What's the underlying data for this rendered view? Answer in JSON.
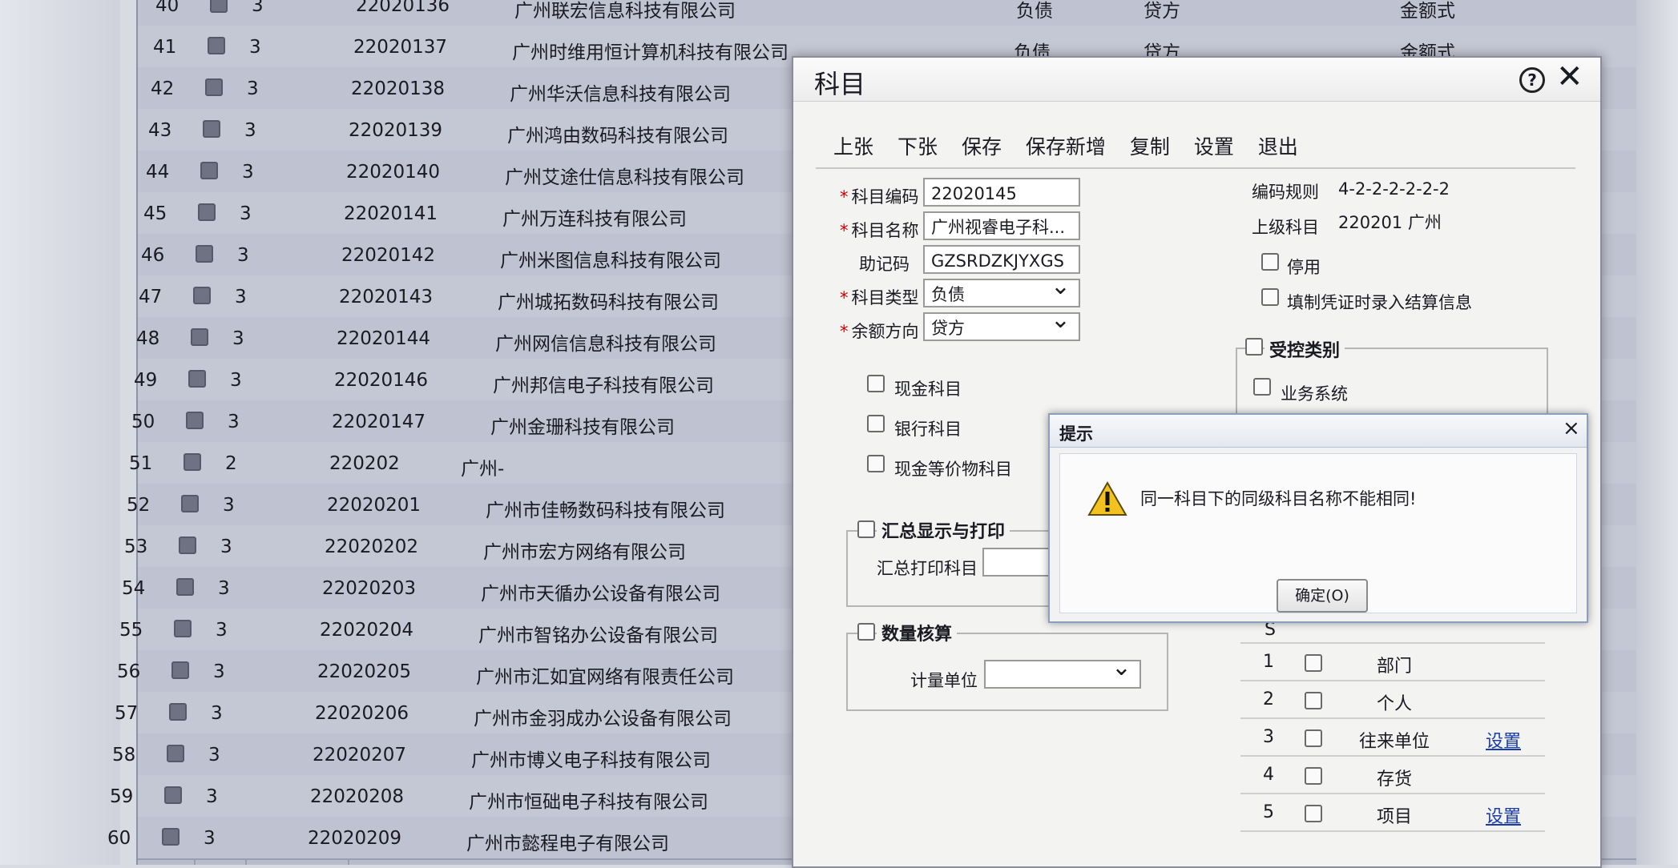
{
  "rows": [
    {
      "num": "40",
      "level": "3",
      "code": "22020136",
      "name": "广州联宏信息科技有限公司",
      "type": "负债",
      "dir": "贷方",
      "fmt": "金额式"
    },
    {
      "num": "41",
      "level": "3",
      "code": "22020137",
      "name": "广州时维用恒计算机科技有限公司",
      "type": "负债",
      "dir": "贷方",
      "fmt": "金额式"
    },
    {
      "num": "42",
      "level": "3",
      "code": "22020138",
      "name": "广州华沃信息科技有限公司",
      "type": "",
      "dir": "",
      "fmt": ""
    },
    {
      "num": "43",
      "level": "3",
      "code": "22020139",
      "name": "广州鸿由数码科技有限公司",
      "type": "",
      "dir": "",
      "fmt": ""
    },
    {
      "num": "44",
      "level": "3",
      "code": "22020140",
      "name": "广州艾途仕信息科技有限公司",
      "type": "",
      "dir": "",
      "fmt": ""
    },
    {
      "num": "45",
      "level": "3",
      "code": "22020141",
      "name": "广州万连科技有限公司",
      "type": "",
      "dir": "",
      "fmt": ""
    },
    {
      "num": "46",
      "level": "3",
      "code": "22020142",
      "name": "广州米图信息科技有限公司",
      "type": "",
      "dir": "",
      "fmt": ""
    },
    {
      "num": "47",
      "level": "3",
      "code": "22020143",
      "name": "广州城拓数码科技有限公司",
      "type": "",
      "dir": "",
      "fmt": ""
    },
    {
      "num": "48",
      "level": "3",
      "code": "22020144",
      "name": "广州网信信息科技有限公司",
      "type": "",
      "dir": "",
      "fmt": ""
    },
    {
      "num": "49",
      "level": "3",
      "code": "22020146",
      "name": "广州邦信电子科技有限公司",
      "type": "",
      "dir": "",
      "fmt": ""
    },
    {
      "num": "50",
      "level": "3",
      "code": "22020147",
      "name": "广州金珊科技有限公司",
      "type": "",
      "dir": "",
      "fmt": ""
    },
    {
      "num": "51",
      "level": "2",
      "code": "220202",
      "name": "广州-",
      "type": "",
      "dir": "",
      "fmt": ""
    },
    {
      "num": "52",
      "level": "3",
      "code": "22020201",
      "name": "广州市佳畅数码科技有限公司",
      "type": "",
      "dir": "",
      "fmt": ""
    },
    {
      "num": "53",
      "level": "3",
      "code": "22020202",
      "name": "广州市宏方网络有限公司",
      "type": "",
      "dir": "",
      "fmt": ""
    },
    {
      "num": "54",
      "level": "3",
      "code": "22020203",
      "name": "广州市天循办公设备有限公司",
      "type": "",
      "dir": "",
      "fmt": ""
    },
    {
      "num": "55",
      "level": "3",
      "code": "22020204",
      "name": "广州市智铭办公设备有限公司",
      "type": "",
      "dir": "",
      "fmt": ""
    },
    {
      "num": "56",
      "level": "3",
      "code": "22020205",
      "name": "广州市汇如宜网络有限责任公司",
      "type": "",
      "dir": "",
      "fmt": ""
    },
    {
      "num": "57",
      "level": "3",
      "code": "22020206",
      "name": "广州市金羽成办公设备有限公司",
      "type": "",
      "dir": "",
      "fmt": ""
    },
    {
      "num": "58",
      "level": "3",
      "code": "22020207",
      "name": "广州市博义电子科技有限公司",
      "type": "",
      "dir": "",
      "fmt": ""
    },
    {
      "num": "59",
      "level": "3",
      "code": "22020208",
      "name": "广州市恒础电子科技有限公司",
      "type": "",
      "dir": "",
      "fmt": ""
    },
    {
      "num": "60",
      "level": "3",
      "code": "22020209",
      "name": "广州市懿程电子有限公司",
      "type": "",
      "dir": "",
      "fmt": ""
    }
  ],
  "dialog": {
    "title": "科目",
    "menu": [
      "上张",
      "下张",
      "保存",
      "保存新增",
      "复制",
      "设置",
      "退出"
    ],
    "labels": {
      "code": "科目编码",
      "name": "科目名称",
      "mnemonic": "助记码",
      "type": "科目类型",
      "direction": "余额方向",
      "rule": "编码规则",
      "parent": "上级科目",
      "disabled": "停用",
      "settle": "填制凭证时录入结算信息",
      "controlled": "受控类别",
      "business": "业务系统",
      "cash": "现金科目",
      "bank": "银行科目",
      "cash_equiv": "现金等价物科目",
      "summary_group": "汇总显示与打印",
      "summary_print": "汇总打印科目",
      "qty_group": "数量核算",
      "unit": "计量单位"
    },
    "values": {
      "code": "22020145",
      "name": "广州视睿电子科...",
      "mnemonic": "GZSRDZKJYXGS",
      "type": "负债",
      "direction": "贷方",
      "rule": "4-2-2-2-2-2-2",
      "parent": "220201 广州"
    },
    "aux_header": "S",
    "aux": [
      {
        "no": "1",
        "name": "部门",
        "action": ""
      },
      {
        "no": "2",
        "name": "个人",
        "action": ""
      },
      {
        "no": "3",
        "name": "往来单位",
        "action": "设置"
      },
      {
        "no": "4",
        "name": "存货",
        "action": ""
      },
      {
        "no": "5",
        "name": "项目",
        "action": "设置"
      }
    ]
  },
  "alert": {
    "title": "提示",
    "message": "同一科目下的同级科目名称不能相同!",
    "ok": "确定(O)"
  }
}
